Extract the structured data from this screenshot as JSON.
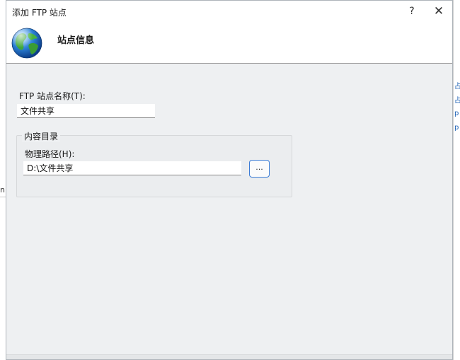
{
  "window": {
    "title": "添加 FTP 站点",
    "help_label": "?",
    "close_label": "✕"
  },
  "header": {
    "title": "站点信息",
    "icon": "globe-icon"
  },
  "form": {
    "site_name_label": "FTP 站点名称(T):",
    "site_name_value": "文件共享",
    "content_group_label": "内容目录",
    "physical_path_label": "物理路径(H):",
    "physical_path_value": "D:\\文件共享",
    "browse_label": "..."
  },
  "background": {
    "left_glyph": "",
    "left_n": "n",
    "right_links": [
      "占",
      "占",
      "p",
      "p"
    ]
  },
  "colors": {
    "accent": "#3a7bd5",
    "dialog_bg": "#eef0f2",
    "header_bg": "#ffffff"
  }
}
